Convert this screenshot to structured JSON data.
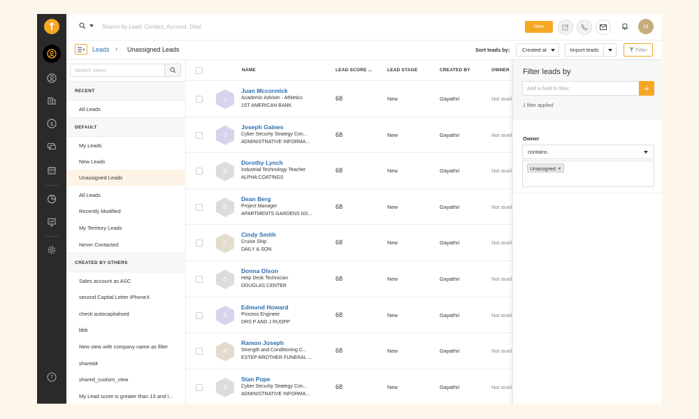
{
  "topbar": {
    "search_placeholder": "Search by Lead, Contact, Account, Deal",
    "new_label": "New",
    "avatar_initial": "H"
  },
  "subheader": {
    "crumb_root": "Leads",
    "crumb_sep": "›",
    "crumb_current": "Unassigned Leads",
    "sort_label": "Sort leads by:",
    "sort_value": "Created at",
    "import_label": "Import leads",
    "filter_label": "Filter"
  },
  "views": {
    "search_placeholder": "Search views",
    "sections": [
      {
        "title": "RECENT",
        "items": [
          "All Leads"
        ]
      },
      {
        "title": "DEFAULT",
        "items": [
          "My Leads",
          "New Leads",
          "Unassigned Leads",
          "All Leads",
          "Recently Modified",
          "My Territory Leads",
          "Never Contacted"
        ]
      },
      {
        "title": "CREATED BY OTHERS",
        "items": [
          "Sales account as ASC",
          "second Captial Letter iPhoneX",
          "check autocapitalised",
          "bbb",
          "New view with company name as filter",
          "shared4",
          "shared_custom_view",
          "My Lead score is greater than 13 and l..."
        ]
      }
    ],
    "active_item": "Unassigned Leads"
  },
  "table": {
    "headers": {
      "name": "NAME",
      "score": "LEAD SCORE ...",
      "stage": "LEAD STAGE",
      "created_by": "CREATED BY",
      "owner": "OWNER"
    },
    "rows": [
      {
        "initial": "J",
        "name": "Juan Mccormick",
        "title": "Academic Adviser - Athletics",
        "company": "1ST AMERICAN BANK",
        "score": "68",
        "stage": "New",
        "created_by": "Gayathri",
        "owner": "Not avail"
      },
      {
        "initial": "J",
        "name": "Joseph Gaines",
        "title": "Cyber Security Strategy Con...",
        "company": "ADMINISTRATIVE INFORMA...",
        "score": "68",
        "stage": "New",
        "created_by": "Gayathri",
        "owner": "Not avail"
      },
      {
        "initial": "D",
        "name": "Dorothy Lynch",
        "title": "Industrial Technology Teacher",
        "company": "ALPHA COATINGS",
        "score": "68",
        "stage": "New",
        "created_by": "Gayathri",
        "owner": "Not avail"
      },
      {
        "initial": "D",
        "name": "Dean Berg",
        "title": "Project Manager",
        "company": "APARTMENTS GARDENS NS...",
        "score": "68",
        "stage": "New",
        "created_by": "Gayathri",
        "owner": "Not avail"
      },
      {
        "initial": "C",
        "name": "Cindy Smith",
        "title": "Cruise Ship",
        "company": "DAILY & SON",
        "score": "68",
        "stage": "New",
        "created_by": "Gayathri",
        "owner": "Not avail"
      },
      {
        "initial": "D",
        "name": "Donna Olson",
        "title": "Help Desk Technician",
        "company": "DOUGLAS CENTER",
        "score": "68",
        "stage": "New",
        "created_by": "Gayathri",
        "owner": "Not avail"
      },
      {
        "initial": "E",
        "name": "Edmund Howard",
        "title": "Process Engineer",
        "company": "DRS P AND J RUOPP",
        "score": "68",
        "stage": "New",
        "created_by": "Gayathri",
        "owner": "Not avail"
      },
      {
        "initial": "R",
        "name": "Ramon Joseph",
        "title": "Strength and Conditioning C...",
        "company": "ESTEP BROTHER FUNERAL ...",
        "score": "68",
        "stage": "New",
        "created_by": "Gayathri",
        "owner": "Not avail"
      },
      {
        "initial": "S",
        "name": "Stan Pope",
        "title": "Cyber Security Strategy Con...",
        "company": "ADMINISTRATIVE INFORMA...",
        "score": "68",
        "stage": "New",
        "created_by": "Gayathri",
        "owner": "Not avail"
      }
    ],
    "hex_colors": [
      "#d6d3ea",
      "#d6d3ea",
      "#dcdcdc",
      "#dcdcdc",
      "#e3dccd",
      "#dcdcdc",
      "#d6d3ea",
      "#e3dccd",
      "#dcdcdc"
    ]
  },
  "filter": {
    "title": "Filter leads by",
    "field_placeholder": "Add a field to filter",
    "add_label": "+",
    "applied_count": "1 filter applied",
    "field_label": "Owner",
    "operator": "contains",
    "value_tag": "Unassigned",
    "value_remove": "×"
  },
  "colors": {
    "accent": "#f5a623",
    "link": "#2a6fb0",
    "rail": "#2a2a2a"
  }
}
